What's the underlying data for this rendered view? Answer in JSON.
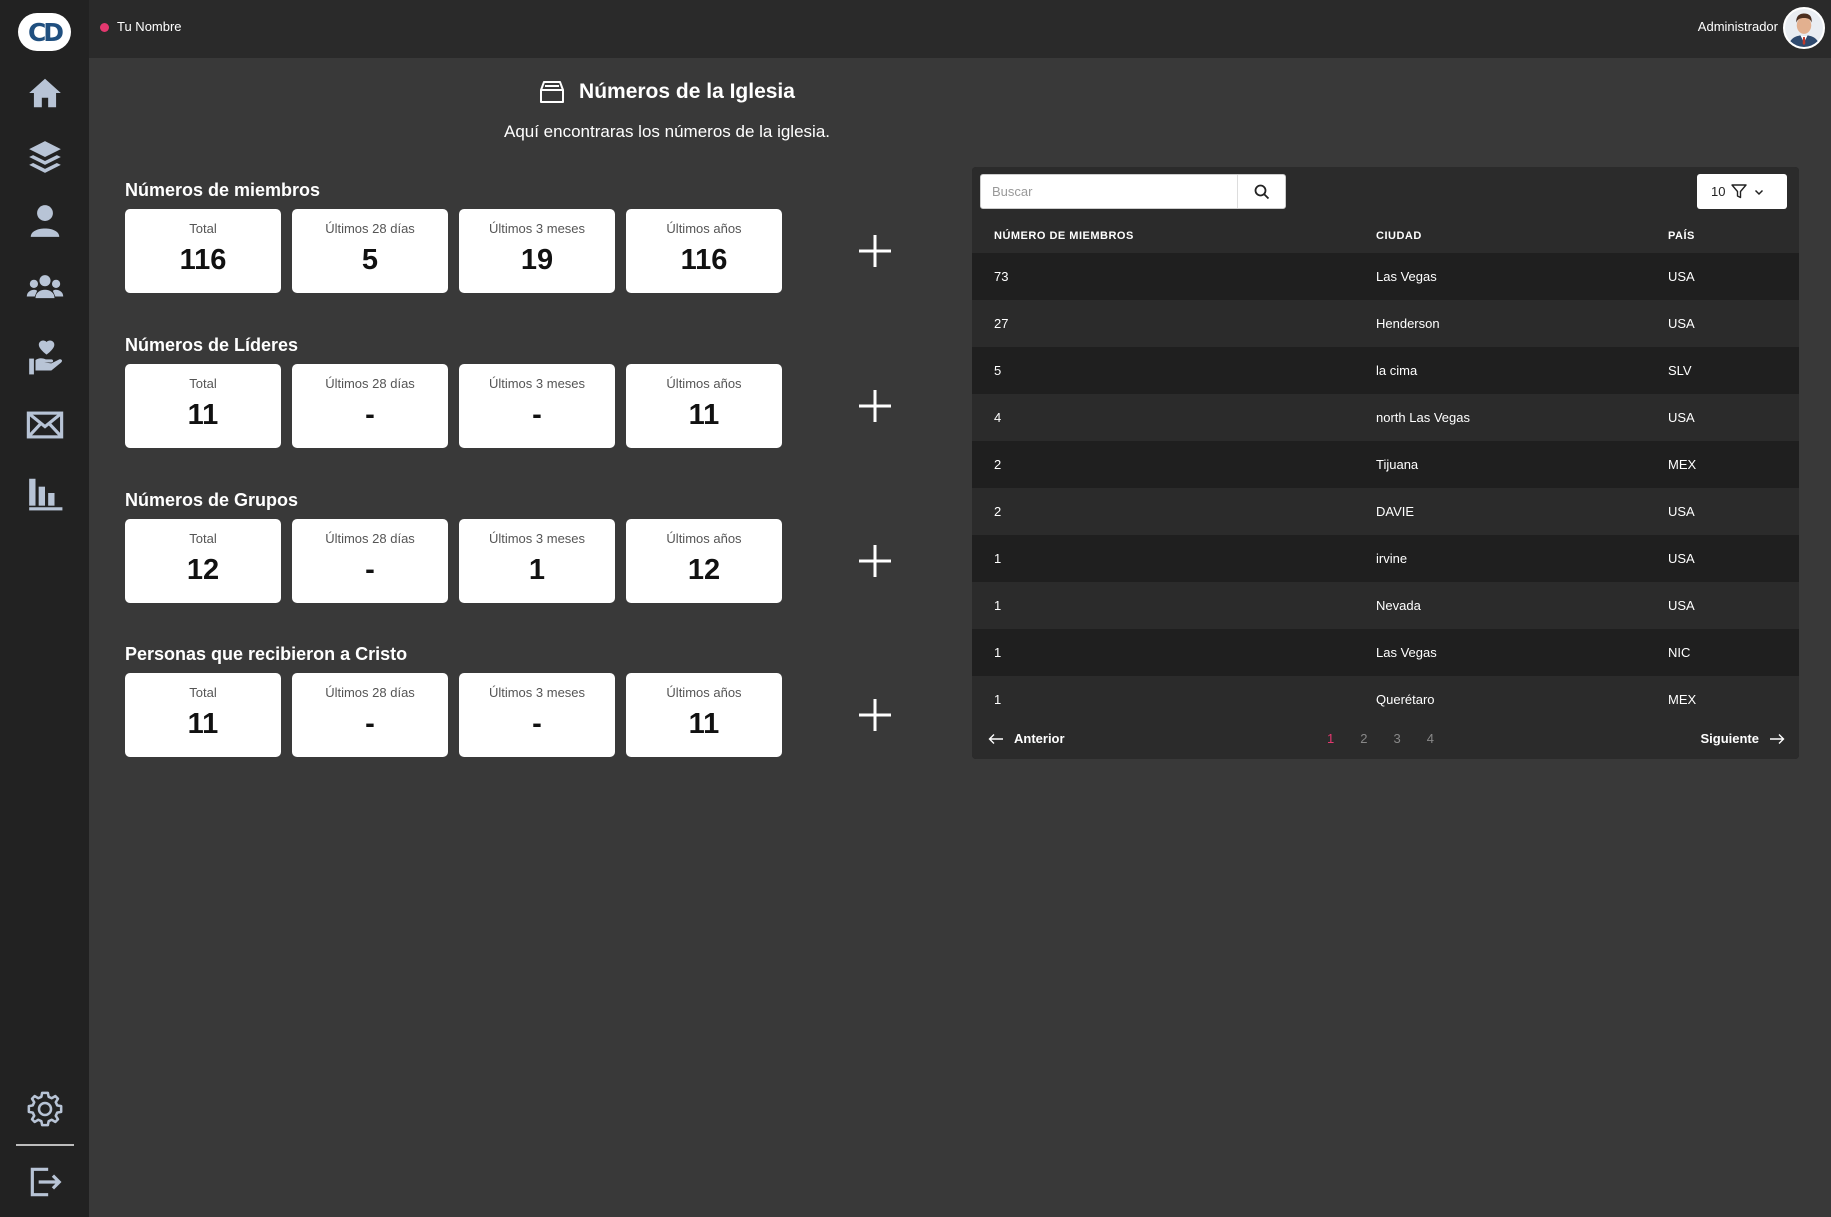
{
  "sidebar": {
    "logo_text": "CD",
    "items": [
      {
        "icon": "home-icon"
      },
      {
        "icon": "layers-icon"
      },
      {
        "icon": "user-icon"
      },
      {
        "icon": "group-icon"
      },
      {
        "icon": "hand-heart-icon"
      },
      {
        "icon": "mail-icon"
      },
      {
        "icon": "bar-chart-icon"
      }
    ],
    "bottom": [
      {
        "icon": "gear-icon"
      },
      {
        "icon": "logout-icon"
      }
    ]
  },
  "topbar": {
    "user_name": "Tu Nombre",
    "status_color": "#e3386f",
    "role": "Administrador"
  },
  "header": {
    "title": "Números de la Iglesia",
    "subtitle": "Aquí encontraras los números de la iglesia."
  },
  "sections": [
    {
      "title": "Números de miembros",
      "cards": [
        {
          "label": "Total",
          "value": "116"
        },
        {
          "label": "Últimos 28 días",
          "value": "5"
        },
        {
          "label": "Últimos 3 meses",
          "value": "19"
        },
        {
          "label": "Últimos años",
          "value": "116"
        }
      ]
    },
    {
      "title": "Números de Líderes",
      "cards": [
        {
          "label": "Total",
          "value": "11"
        },
        {
          "label": "Últimos 28 días",
          "value": "-"
        },
        {
          "label": "Últimos 3 meses",
          "value": "-"
        },
        {
          "label": "Últimos años",
          "value": "11"
        }
      ]
    },
    {
      "title": "Números de Grupos",
      "cards": [
        {
          "label": "Total",
          "value": "12"
        },
        {
          "label": "Últimos 28 días",
          "value": "-"
        },
        {
          "label": "Últimos 3 meses",
          "value": "1"
        },
        {
          "label": "Últimos años",
          "value": "12"
        }
      ]
    },
    {
      "title": "Personas que recibieron a Cristo",
      "cards": [
        {
          "label": "Total",
          "value": "11"
        },
        {
          "label": "Últimos 28 días",
          "value": "-"
        },
        {
          "label": "Últimos 3 meses",
          "value": "-"
        },
        {
          "label": "Últimos años",
          "value": "11"
        }
      ]
    }
  ],
  "table": {
    "search_placeholder": "Buscar",
    "page_size": "10",
    "columns": [
      "NÚMERO DE MIEMBROS",
      "CIUDAD",
      "PAÍS"
    ],
    "rows": [
      [
        "73",
        "Las Vegas",
        "USA"
      ],
      [
        "27",
        "Henderson",
        "USA"
      ],
      [
        "5",
        "la cima",
        "SLV"
      ],
      [
        "4",
        "north Las Vegas",
        "USA"
      ],
      [
        "2",
        "Tijuana",
        "MEX"
      ],
      [
        "2",
        "DAVIE",
        "USA"
      ],
      [
        "1",
        "irvine",
        "USA"
      ],
      [
        "1",
        "Nevada",
        "USA"
      ],
      [
        "1",
        "Las Vegas",
        "NIC"
      ],
      [
        "1",
        "Querétaro",
        "MEX"
      ]
    ],
    "pager": {
      "prev": "Anterior",
      "next": "Siguiente",
      "pages": [
        "1",
        "2",
        "3",
        "4"
      ],
      "active_page": "1"
    }
  }
}
